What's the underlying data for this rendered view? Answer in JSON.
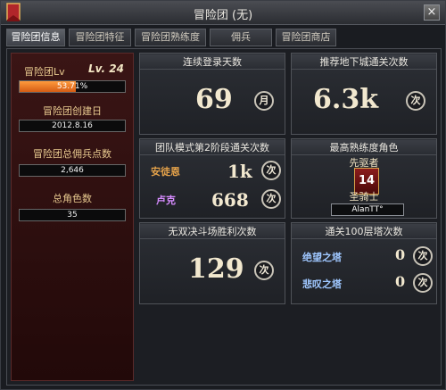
{
  "window": {
    "title": "冒险团 (无)",
    "close_label": "×"
  },
  "tabs": [
    {
      "label": "冒险团信息",
      "active": true
    },
    {
      "label": "冒险团特征",
      "active": false
    },
    {
      "label": "冒险团熟练度",
      "active": false
    },
    {
      "label": "佣兵",
      "active": false
    },
    {
      "label": "冒险团商店",
      "active": false
    }
  ],
  "sidebar": {
    "level_label": "冒险团Lv",
    "level_value": "Lv. 24",
    "progress_text": "53.71%",
    "progress_fraction": 0.5371,
    "created_label": "冒险团创建日",
    "created_value": "2012.8.16",
    "mercenary_points_label": "冒险团总佣兵点数",
    "mercenary_points_value": "2,646",
    "total_characters_label": "总角色数",
    "total_characters_value": "35"
  },
  "panels": {
    "login_streak": {
      "title": "连续登录天数",
      "value": "69",
      "unit": "月"
    },
    "dungeon_clears": {
      "title": "推荐地下城通关次数",
      "value": "6.3k",
      "unit": "次"
    },
    "team_mode": {
      "title": "团队模式第2阶段通关次数",
      "rows": [
        {
          "name": "安徒恩",
          "value": "1k",
          "unit": "次"
        },
        {
          "name": "卢克",
          "value": "668",
          "unit": "次"
        }
      ]
    },
    "top_proficiency": {
      "title": "最高熟练度角色",
      "rank_label": "先驱者",
      "rank_number": "14",
      "job": "圣骑士",
      "character_name": "AlanTT°"
    },
    "arena_wins": {
      "title": "无双决斗场胜利次数",
      "value": "129",
      "unit": "次"
    },
    "tower_100": {
      "title": "通关100层塔次数",
      "rows": [
        {
          "name": "绝望之塔",
          "value": "0",
          "unit": "次"
        },
        {
          "name": "悲叹之塔",
          "value": "0",
          "unit": "次"
        }
      ]
    }
  },
  "colors": {
    "accent_gold": "#e7c98f",
    "sidebar_red": "#3a1515",
    "progress_orange": "#d55c14",
    "name_orange": "#e3a14a",
    "name_purple": "#d68cff",
    "tower_blue": "#9fc7ff"
  }
}
